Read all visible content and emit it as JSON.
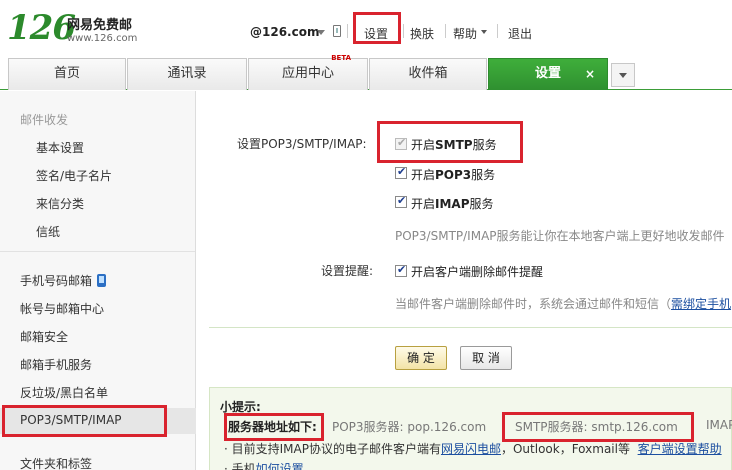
{
  "brand": {
    "number": "126",
    "name_cn": "网易免费邮",
    "url": "www.126.com"
  },
  "topbar": {
    "account": "@126.com",
    "settings": "设置",
    "skin": "换肤",
    "help": "帮助",
    "logout": "退出"
  },
  "tabs": [
    {
      "label": "首页"
    },
    {
      "label": "通讯录"
    },
    {
      "label": "应用中心",
      "badge": "BETA"
    },
    {
      "label": "收件箱"
    },
    {
      "label": "设置",
      "close": "×"
    }
  ],
  "sidebar": {
    "group1": "邮件收发",
    "sub": [
      "基本设置",
      "签名/电子名片",
      "来信分类",
      "信纸"
    ],
    "main": [
      "手机号码邮箱",
      "帐号与邮箱中心",
      "邮箱安全",
      "邮箱手机服务",
      "反垃圾/黑白名单",
      "POP3/SMTP/IMAP",
      "文件夹和标签"
    ]
  },
  "form": {
    "setting_label": "设置POP3/SMTP/IMAP:",
    "smtp": {
      "prefix": "开启",
      "proto": "SMTP",
      "suffix": "服务",
      "checked": true,
      "disabled": true
    },
    "pop3": {
      "prefix": "开启",
      "proto": "POP3",
      "suffix": "服务",
      "checked": true
    },
    "imap": {
      "prefix": "开启",
      "proto": "IMAP",
      "suffix": "服务",
      "checked": true
    },
    "service_hint": "POP3/SMTP/IMAP服务能让你在本地客户端上更好地收发邮件",
    "reminder_label": "设置提醒:",
    "reminder": {
      "text": "开启客户端删除邮件提醒",
      "checked": true
    },
    "reminder_hint": "当邮件客户端删除邮件时，系统会通过邮件和短信（",
    "reminder_link": "需绑定手机"
  },
  "buttons": {
    "ok": "确 定",
    "cancel": "取 消"
  },
  "tips": {
    "title": "小提示:",
    "servers_label": "服务器地址如下:",
    "pop3": "POP3服务器: pop.126.com",
    "smtp": "SMTP服务器: smtp.126.com",
    "imap": "IMAP",
    "line1_prefix": "· 目前支持IMAP协议的电子邮件客户端有",
    "line1_link": "网易闪电邮",
    "line1_suffix": "，Outlook，Foxmail等",
    "line1_help": "客户端设置帮助",
    "line2_prefix": "· 手机",
    "line2_link": "如何设置"
  },
  "colors": {
    "brand_green": "#2c8a2c",
    "tab_active": "#3b9d38",
    "highlight": "#d9232e",
    "link": "#1c4fa0"
  }
}
